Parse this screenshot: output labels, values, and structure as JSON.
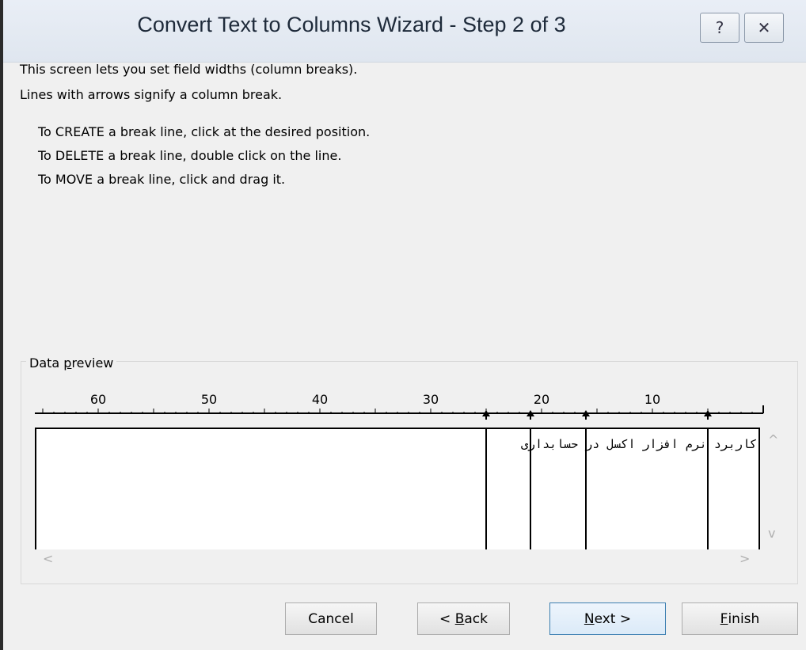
{
  "window": {
    "title": "Convert Text to Columns Wizard - Step 2 of 3",
    "help_glyph": "?",
    "close_glyph": "✕"
  },
  "intro": {
    "line1": "This screen lets you set field widths (column breaks).",
    "line2": "Lines with arrows signify a column break.",
    "create": "To CREATE a break line, click at the desired position.",
    "delete": "To DELETE a break line, double click on the line.",
    "move": "To MOVE a break line, click and drag it."
  },
  "preview": {
    "label_prefix": "Data ",
    "label_accel": "p",
    "label_suffix": "review",
    "ruler_labels": [
      "60",
      "50",
      "40",
      "30",
      "20",
      "10"
    ],
    "break_columns": [
      5,
      16,
      21,
      25
    ],
    "row_text": "کاربرد نرم افزار اکسل در حسابداری"
  },
  "scroll": {
    "up": "^",
    "down": "v",
    "left": "<",
    "right": ">"
  },
  "buttons": {
    "cancel": "Cancel",
    "back_prefix": "< ",
    "back_accel": "B",
    "back_suffix": "ack",
    "next_accel": "N",
    "next_suffix": "ext >",
    "finish_accel": "F",
    "finish_suffix": "inish"
  }
}
